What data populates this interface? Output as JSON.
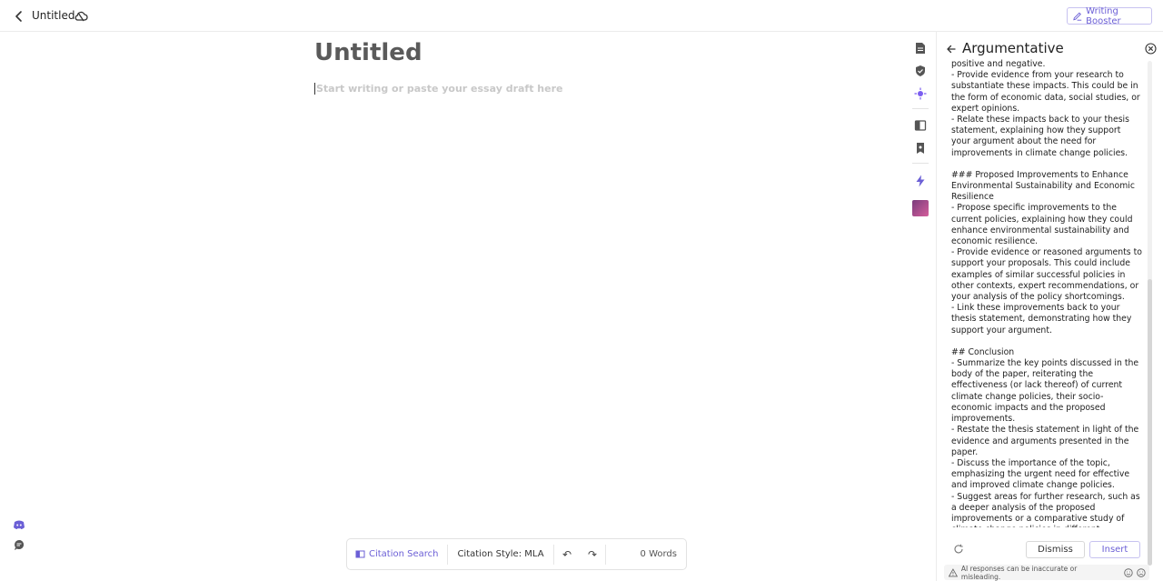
{
  "header": {
    "doc_name": "Untitled",
    "writing_booster_label": "Writing Booster",
    "icons": [
      "back-arrow-icon",
      "cloud-off-icon",
      "pen-icon"
    ]
  },
  "editor": {
    "title": "Untitled",
    "placeholder": "Start writing or paste your essay draft here"
  },
  "left_icons": [
    "discord-icon",
    "chat-icon"
  ],
  "toolbar": {
    "citation_search_label": "Citation Search",
    "citation_style_label": "Citation Style: MLA",
    "word_count": "0 Words"
  },
  "rail": {
    "icons": [
      "document-icon",
      "shield-check-icon",
      "sparkle-icon",
      "book-icon",
      "bookmark-icon",
      "lightning-icon",
      "avatar-icon"
    ]
  },
  "panel": {
    "title": "Argumentative",
    "content": [
      "positive and negative.\n- Provide evidence from your research to substantiate these impacts. This could be in the form of economic data, social studies, or expert opinions.\n- Relate these impacts back to your thesis statement, explaining how they support your argument about the need for improvements in climate change policies.",
      "### Proposed Improvements to Enhance Environmental Sustainability and Economic Resilience\n- Propose specific improvements to the current policies, explaining how they could enhance environmental sustainability and economic resilience.\n- Provide evidence or reasoned arguments to support your proposals. This could include examples of similar successful policies in other contexts, expert recommendations, or your analysis of the policy shortcomings.\n- Link these improvements back to your thesis statement, demonstrating how they support your argument.",
      "## Conclusion\n- Summarize the key points discussed in the body of the paper, reiterating the effectiveness (or lack thereof) of current climate change policies, their socio-economic impacts and the proposed improvements.\n- Restate the thesis statement in light of the evidence and arguments presented in the paper.\n- Discuss the importance of the topic, emphasizing the urgent need for effective and improved climate change policies.\n- Suggest areas for further research, such as a deeper analysis of the proposed improvements or a comparative study of climate change policies in different countries."
    ],
    "dismiss_label": "Dismiss",
    "insert_label": "Insert",
    "disclaimer": "AI responses can be inaccurate or misleading."
  }
}
